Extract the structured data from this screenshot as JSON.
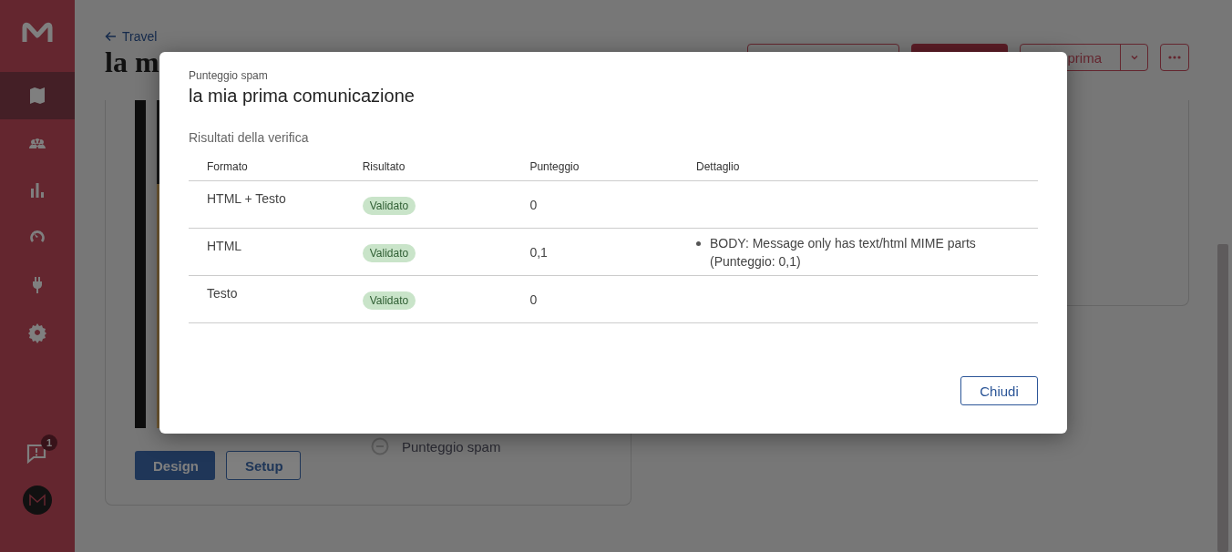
{
  "sidebar": {
    "items": [
      {
        "selected": true
      },
      {
        "selected": false
      },
      {
        "selected": false
      },
      {
        "selected": false
      },
      {
        "selected": false
      },
      {
        "selected": false
      }
    ],
    "notifications_badge": "1"
  },
  "page": {
    "back_link": "Travel",
    "title": "la m",
    "split_button_label": "prima"
  },
  "preview_card": {
    "action": "Punteggio spam",
    "buttons": [
      {
        "label": "Design",
        "kind": "primary"
      },
      {
        "label": "Setup",
        "kind": "secondary"
      }
    ]
  },
  "modal": {
    "subtitle": "Punteggio spam",
    "title": "la mia prima comunicazione",
    "section_title": "Risultati della verifica",
    "table": {
      "columns": [
        "Formato",
        "Risultato",
        "Punteggio",
        "Dettaglio"
      ],
      "rows": [
        {
          "format": "HTML + Testo",
          "result": "Validato",
          "score": "0",
          "details": []
        },
        {
          "format": "HTML",
          "result": "Validato",
          "score": "0,1",
          "details": [
            "BODY: Message only has text/html MIME parts (Punteggio: 0,1)"
          ]
        },
        {
          "format": "Testo",
          "result": "Validato",
          "score": "0",
          "details": []
        }
      ]
    },
    "close_button": "Chiudi"
  }
}
